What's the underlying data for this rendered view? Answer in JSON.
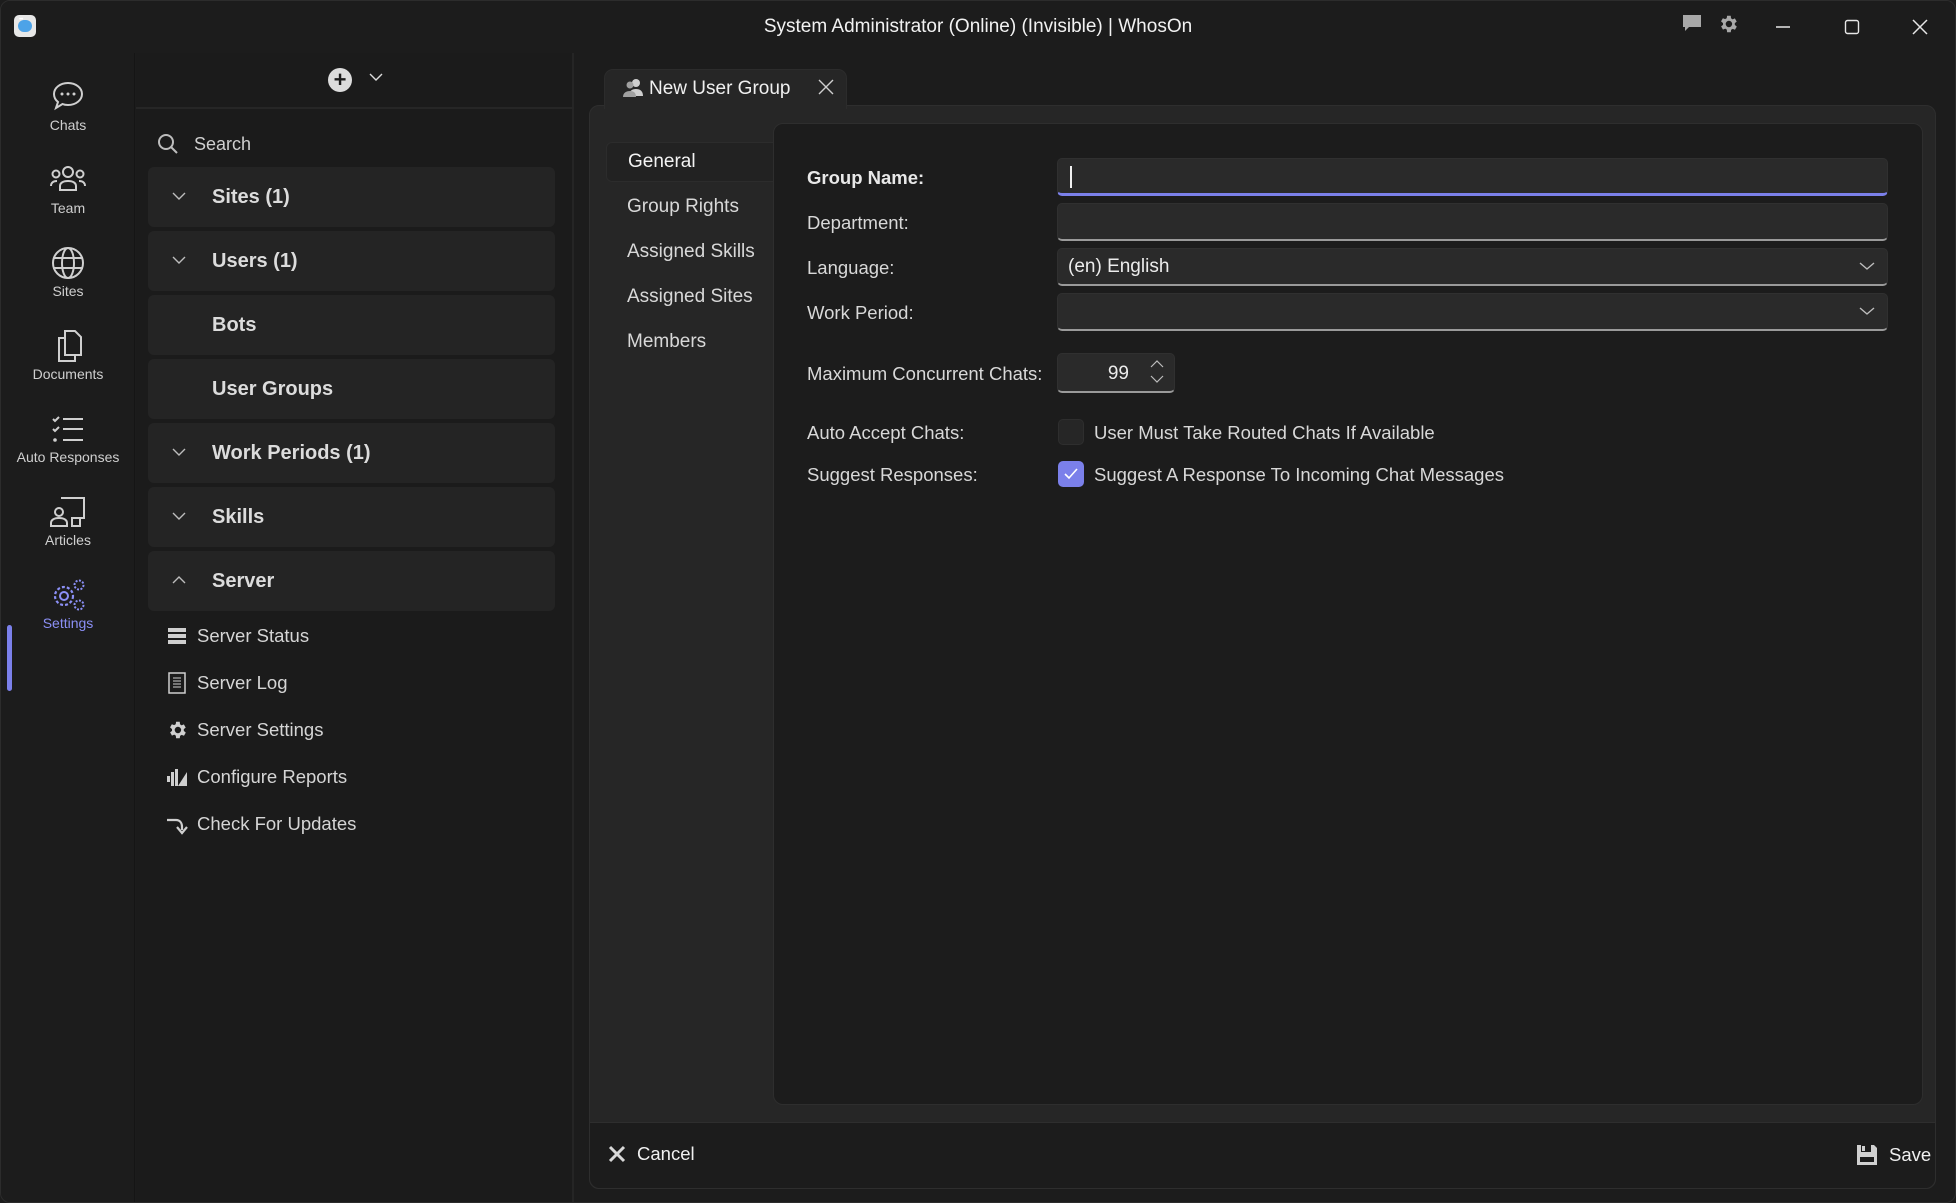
{
  "window": {
    "title": "System Administrator (Online) (Invisible) | WhosOn",
    "controls": [
      "chat-icon",
      "gear-icon",
      "minimize",
      "maximize",
      "close"
    ]
  },
  "rail": {
    "items": [
      {
        "label": "Chats",
        "icon": "chat-bubble-icon",
        "active": false
      },
      {
        "label": "Team",
        "icon": "team-icon",
        "active": false
      },
      {
        "label": "Sites",
        "icon": "globe-icon",
        "active": false
      },
      {
        "label": "Documents",
        "icon": "documents-icon",
        "active": false
      },
      {
        "label": "Auto Responses",
        "icon": "checklist-icon",
        "active": false
      },
      {
        "label": "Articles",
        "icon": "articles-icon",
        "active": false
      },
      {
        "label": "Settings",
        "icon": "settings-gears-icon",
        "active": true
      }
    ],
    "accent": "#7b80ea"
  },
  "tree": {
    "search_placeholder": "Search",
    "sections": [
      {
        "label": "Sites (1)",
        "chevron": "down"
      },
      {
        "label": "Users (1)",
        "chevron": "down"
      },
      {
        "label": "Bots",
        "chevron": null
      },
      {
        "label": "User Groups",
        "chevron": null
      },
      {
        "label": "Work Periods (1)",
        "chevron": "down"
      },
      {
        "label": "Skills",
        "chevron": "down"
      },
      {
        "label": "Server",
        "chevron": "up"
      }
    ],
    "server_items": [
      {
        "label": "Server Status",
        "icon": "server-status-icon"
      },
      {
        "label": "Server Log",
        "icon": "log-document-icon"
      },
      {
        "label": "Server Settings",
        "icon": "gear-icon"
      },
      {
        "label": "Configure Reports",
        "icon": "reports-icon"
      },
      {
        "label": "Check For Updates",
        "icon": "update-arrow-icon"
      }
    ]
  },
  "tab": {
    "label": "New User Group",
    "icon": "user-group-icon"
  },
  "subnav": {
    "items": [
      "General",
      "Group Rights",
      "Assigned Skills",
      "Assigned Sites",
      "Members"
    ],
    "active": "General"
  },
  "form": {
    "group_name": {
      "label": "Group Name:",
      "value": ""
    },
    "department": {
      "label": "Department:",
      "value": ""
    },
    "language": {
      "label": "Language:",
      "value": "(en) English"
    },
    "work_period": {
      "label": "Work Period:",
      "value": ""
    },
    "max_chats": {
      "label": "Maximum Concurrent Chats:",
      "value": "99"
    },
    "auto_accept": {
      "label": "Auto Accept Chats:",
      "option": "User Must Take Routed Chats If Available",
      "checked": false
    },
    "suggest": {
      "label": "Suggest Responses:",
      "option": "Suggest A Response To Incoming Chat Messages",
      "checked": true
    }
  },
  "footer": {
    "cancel_label": "Cancel",
    "save_label": "Save"
  }
}
